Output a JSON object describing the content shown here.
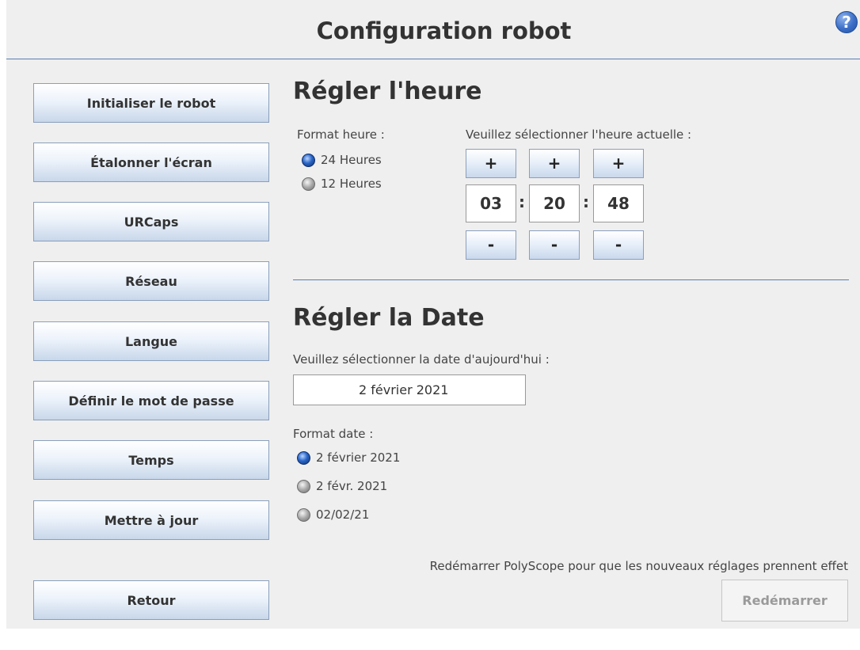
{
  "header": {
    "title": "Configuration robot",
    "help_icon": "?"
  },
  "nav": {
    "items": [
      {
        "label": "Initialiser le robot"
      },
      {
        "label": "Étalonner l'écran"
      },
      {
        "label": "URCaps"
      },
      {
        "label": "Réseau"
      },
      {
        "label": "Langue"
      },
      {
        "label": "Définir le mot de passe"
      },
      {
        "label": "Temps"
      },
      {
        "label": "Mettre à jour"
      }
    ],
    "back_label": "Retour"
  },
  "time": {
    "heading": "Régler l'heure",
    "format_label": "Format heure :",
    "format_options": [
      {
        "label": "24 Heures",
        "selected": true
      },
      {
        "label": "12 Heures",
        "selected": false
      }
    ],
    "select_label": "Veuillez sélectionner l'heure actuelle :",
    "plus": "+",
    "minus": "-",
    "separator": ":",
    "hours": "03",
    "minutes": "20",
    "seconds": "48"
  },
  "date": {
    "heading": "Régler la Date",
    "select_label": "Veuillez sélectionner la date d'aujourd'hui :",
    "value": "2 février 2021",
    "format_label": "Format date :",
    "format_options": [
      {
        "label": "2 février 2021",
        "selected": true
      },
      {
        "label": "2 févr. 2021",
        "selected": false
      },
      {
        "label": "02/02/21",
        "selected": false
      }
    ]
  },
  "footer": {
    "notice": "Redémarrer PolyScope pour que les nouveaux réglages prennent effet",
    "restart_label": "Redémarrer"
  },
  "colors": {
    "accent": "#5a7fb3",
    "selected_radio": "#2a66c8",
    "background": "#efefef"
  }
}
